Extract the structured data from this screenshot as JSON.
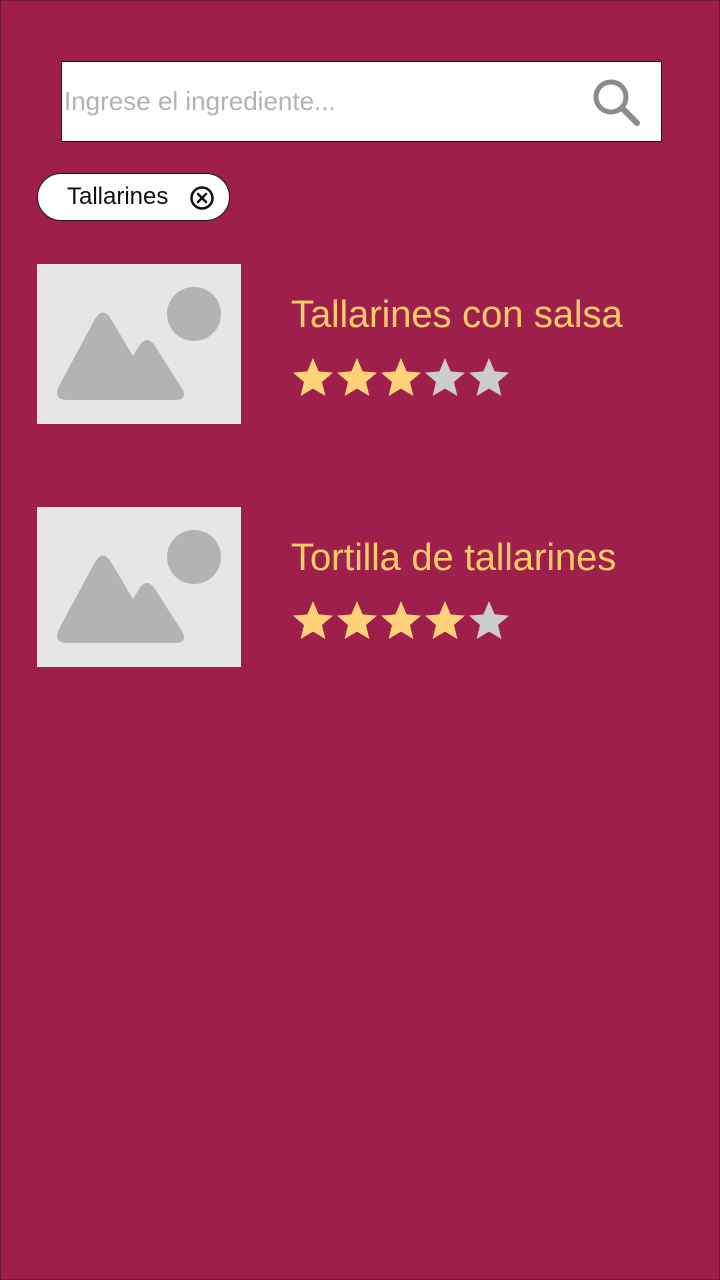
{
  "search": {
    "placeholder": "Ingrese el ingrediente...",
    "value": "",
    "icon": "search-icon"
  },
  "filter_chip": {
    "label": "Tallarines",
    "icon": "close-circle-icon"
  },
  "colors": {
    "background": "#9e1f4c",
    "title": "#ffcc66",
    "star_filled": "#ffd27a",
    "star_empty": "#cccccc",
    "thumb_bg": "#e6e6e6",
    "thumb_shape": "#b3b3b3"
  },
  "recipes": [
    {
      "title": "Tallarines con salsa",
      "image": "image-placeholder-icon",
      "rating": 3,
      "max_rating": 5
    },
    {
      "title": "Tortilla de tallarines",
      "image": "image-placeholder-icon",
      "rating": 4,
      "max_rating": 5
    }
  ]
}
